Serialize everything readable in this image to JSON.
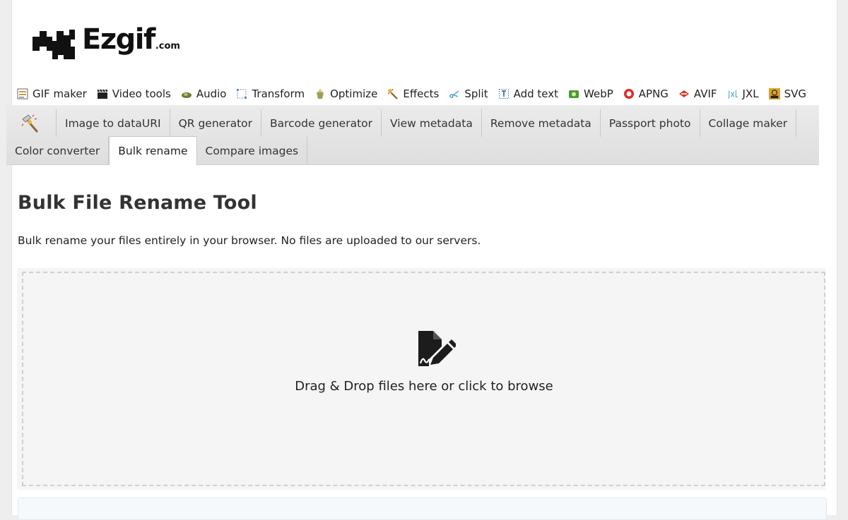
{
  "logo": {
    "text": "Ezgif",
    "suffix": ".com"
  },
  "topnav": [
    {
      "label": "GIF maker",
      "icon": "gif-maker-icon"
    },
    {
      "label": "Video tools",
      "icon": "clapperboard-icon"
    },
    {
      "label": "Audio",
      "icon": "speaker-icon"
    },
    {
      "label": "Transform",
      "icon": "transform-icon"
    },
    {
      "label": "Optimize",
      "icon": "optimize-icon"
    },
    {
      "label": "Effects",
      "icon": "magic-wand-icon"
    },
    {
      "label": "Split",
      "icon": "scissors-icon"
    },
    {
      "label": "Add text",
      "icon": "text-icon"
    },
    {
      "label": "WebP",
      "icon": "webp-icon"
    },
    {
      "label": "APNG",
      "icon": "apng-icon"
    },
    {
      "label": "AVIF",
      "icon": "avif-icon"
    },
    {
      "label": "JXL",
      "icon": "jxl-icon"
    },
    {
      "label": "SVG",
      "icon": "svg-icon"
    }
  ],
  "subnav": {
    "row1": [
      "Image to dataURI",
      "QR generator",
      "Barcode generator",
      "View metadata",
      "Remove metadata",
      "Passport photo",
      "Collage maker"
    ],
    "row2": [
      "Color converter",
      "Bulk rename",
      "Compare images"
    ]
  },
  "page": {
    "title": "Bulk File Rename Tool",
    "description": "Bulk rename your files entirely in your browser. No files are uploaded to our servers."
  },
  "dropzone": {
    "text": "Drag & Drop files here or click to browse",
    "icon": "file-signature-icon"
  },
  "colors": {
    "page_bg": "#eeeeee",
    "content_bg": "#ffffff",
    "nav_bg": "#e4e4e4",
    "dropzone_bg": "#f5f5f5"
  }
}
